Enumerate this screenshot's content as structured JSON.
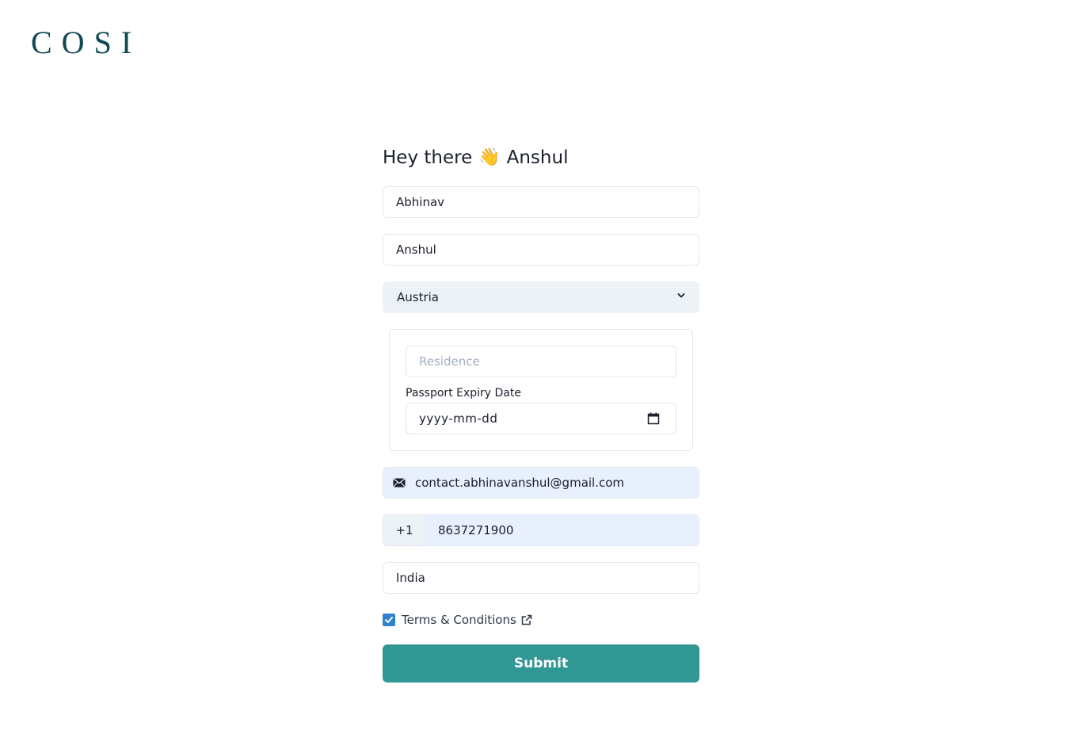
{
  "brand": {
    "logo_text": "COSI"
  },
  "greeting": {
    "prefix": "Hey there",
    "emoji": "👋",
    "name": "Anshul"
  },
  "form": {
    "first_name": "Abhinav",
    "last_name": "Anshul",
    "country": {
      "selected": "Austria"
    },
    "residence_placeholder": "Residence",
    "passport_expiry": {
      "label": "Passport Expiry Date",
      "placeholder": "yyyy-mm-dd"
    },
    "email": "contact.abhinavanshul@gmail.com",
    "phone": {
      "country_code": "+1",
      "number": "8637271900"
    },
    "nationality": "India",
    "terms": {
      "label": "Terms & Conditions",
      "checked": true
    },
    "submit_label": "Submit"
  },
  "colors": {
    "brand": "#0f4a52",
    "accent": "#319795",
    "checkbox": "#3182ce",
    "autofill_bg": "#e8f0fe",
    "select_bg": "#edf2f7"
  },
  "icons": {
    "country_select": "chevron-down-icon",
    "passport_expiry": "calendar-icon",
    "email": "mail-icon",
    "terms": "external-link-icon",
    "terms_checkbox": "check-icon"
  }
}
